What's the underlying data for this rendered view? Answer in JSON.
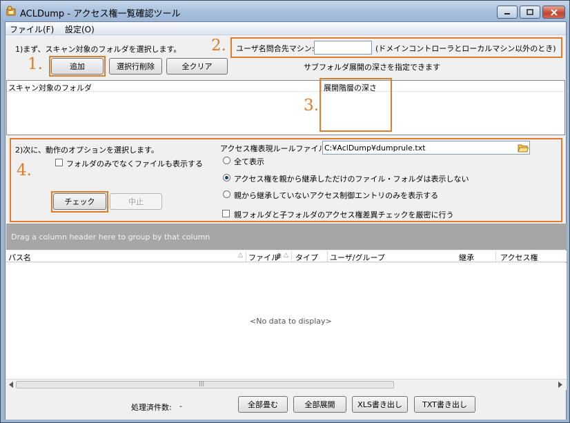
{
  "window": {
    "title": "ACLDump - アクセス権一覧確認ツール"
  },
  "menu": {
    "file": "ファイル(F)",
    "settings": "設定(O)"
  },
  "step1": {
    "instruction": "1)まず、スキャン対象のフォルダを選択します。",
    "add_button": "追加",
    "delete_button": "選択行削除",
    "clear_button": "全クリア",
    "subfolder_note": "サブフォルダ展開の深さを指定できます"
  },
  "user_query": {
    "label": "ユーザ名問合先マシン:",
    "value": "",
    "note": "(ドメインコントローラとローカルマシン以外のとき)"
  },
  "folder_table": {
    "columns": [
      "スキャン対象のフォルダ",
      "展開階層の深さ"
    ]
  },
  "step2": {
    "instruction": "2)次に、動作のオプションを選択します。",
    "rule_file_label": "アクセス権表現ルールファイル:",
    "rule_file_value": "C:¥AclDump¥dumprule.txt",
    "show_files_checkbox": "フォルダのみでなくファイルも表示する",
    "show_files_checked": false,
    "radio_options": [
      "全て表示",
      "アクセス権を親から継承しただけのファイル・フォルダは表示しない",
      "親から継承していないアクセス制御エントリのみを表示する"
    ],
    "selected_radio": 1,
    "strict_check": "親フォルダと子フォルダのアクセス権差異チェックを厳密に行う",
    "strict_checked": false,
    "check_button": "チェック",
    "stop_button": "中止"
  },
  "annotations": [
    "1.",
    "2.",
    "3.",
    "4."
  ],
  "results_grid": {
    "group_hint": "Drag a column header here to group by that column",
    "columns": [
      "パス名",
      "ファイル",
      "#",
      "タイプ",
      "ユーザ/グループ",
      "継承",
      "アクセス権"
    ],
    "empty_text": "<No data to display>"
  },
  "footer": {
    "processed_label": "処理済件数:",
    "processed_value": "-",
    "collapse_all": "全部畳む",
    "expand_all": "全部展開",
    "export_xls": "XLS書き出し",
    "export_txt": "TXT書き出し"
  },
  "colors": {
    "highlight": "#e07b29",
    "title_bar": "#a9c1de",
    "group_panel": "#a6a6a6"
  }
}
